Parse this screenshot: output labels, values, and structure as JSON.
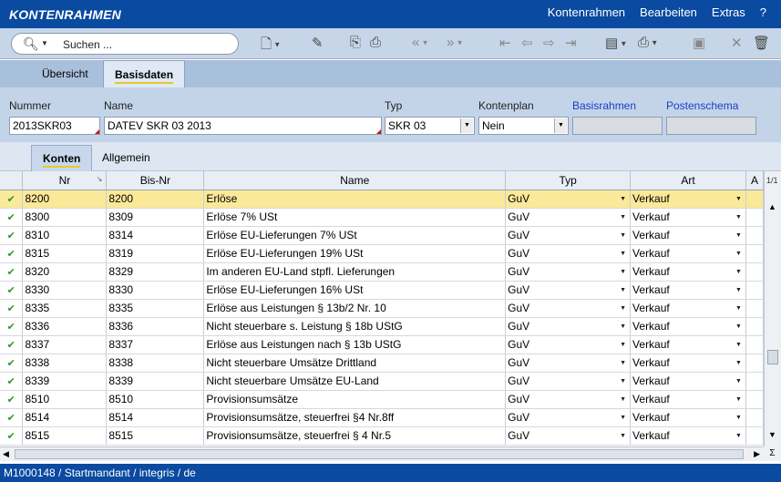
{
  "app": {
    "title": "KONTENRAHMEN",
    "menu": [
      "Kontenrahmen",
      "Bearbeiten",
      "Extras",
      "?"
    ]
  },
  "toolbar": {
    "search_placeholder": "Suchen ..."
  },
  "tabs_top": [
    {
      "label": "Übersicht",
      "active": false
    },
    {
      "label": "Basisdaten",
      "active": true
    }
  ],
  "form": {
    "nummer_label": "Nummer",
    "nummer_value": "2013SKR03",
    "name_label": "Name",
    "name_value": "DATEV SKR 03 2013",
    "typ_label": "Typ",
    "typ_value": "SKR 03",
    "kontenplan_label": "Kontenplan",
    "kontenplan_value": "Nein",
    "basisrahmen_label": "Basisrahmen",
    "basisrahmen_value": "",
    "postenschema_label": "Postenschema",
    "postenschema_value": ""
  },
  "tabs_sub": [
    {
      "label": "Konten",
      "active": true
    },
    {
      "label": "Allgemein",
      "active": false
    }
  ],
  "grid": {
    "columns": [
      "Nr",
      "Bis-Nr",
      "Name",
      "Typ",
      "Art",
      "A"
    ],
    "page_info": "1/1",
    "rows": [
      {
        "nr": "8200",
        "bis": "8200",
        "name": "Erlöse",
        "typ": "GuV",
        "art": "Verkauf",
        "selected": true
      },
      {
        "nr": "8300",
        "bis": "8309",
        "name": "Erlöse 7% USt",
        "typ": "GuV",
        "art": "Verkauf"
      },
      {
        "nr": "8310",
        "bis": "8314",
        "name": "Erlöse EU-Lieferungen 7% USt",
        "typ": "GuV",
        "art": "Verkauf"
      },
      {
        "nr": "8315",
        "bis": "8319",
        "name": "Erlöse EU-Lieferungen 19% USt",
        "typ": "GuV",
        "art": "Verkauf"
      },
      {
        "nr": "8320",
        "bis": "8329",
        "name": "Im anderen EU-Land stpfl. Lieferungen",
        "typ": "GuV",
        "art": "Verkauf"
      },
      {
        "nr": "8330",
        "bis": "8330",
        "name": "Erlöse EU-Lieferungen 16% USt",
        "typ": "GuV",
        "art": "Verkauf"
      },
      {
        "nr": "8335",
        "bis": "8335",
        "name": "Erlöse aus Leistungen § 13b/2 Nr. 10",
        "typ": "GuV",
        "art": "Verkauf"
      },
      {
        "nr": "8336",
        "bis": "8336",
        "name": "Nicht steuerbare s. Leistung § 18b UStG",
        "typ": "GuV",
        "art": "Verkauf"
      },
      {
        "nr": "8337",
        "bis": "8337",
        "name": "Erlöse aus Leistungen nach § 13b UStG",
        "typ": "GuV",
        "art": "Verkauf"
      },
      {
        "nr": "8338",
        "bis": "8338",
        "name": "Nicht steuerbare Umsätze Drittland",
        "typ": "GuV",
        "art": "Verkauf"
      },
      {
        "nr": "8339",
        "bis": "8339",
        "name": "Nicht steuerbare Umsätze EU-Land",
        "typ": "GuV",
        "art": "Verkauf"
      },
      {
        "nr": "8510",
        "bis": "8510",
        "name": "Provisionsumsätze",
        "typ": "GuV",
        "art": "Verkauf"
      },
      {
        "nr": "8514",
        "bis": "8514",
        "name": "Provisionsumsätze, steuerfrei §4 Nr.8ff",
        "typ": "GuV",
        "art": "Verkauf"
      },
      {
        "nr": "8515",
        "bis": "8515",
        "name": "Provisionsumsätze, steuerfrei § 4 Nr.5",
        "typ": "GuV",
        "art": "Verkauf"
      }
    ]
  },
  "status": {
    "text": "M1000148 / Startmandant / integris / de"
  }
}
